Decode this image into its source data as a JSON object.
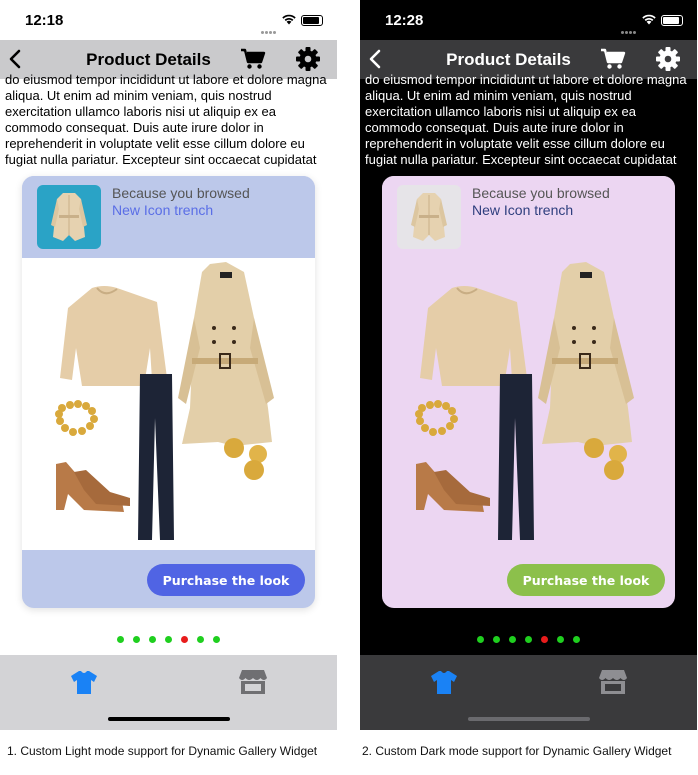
{
  "light": {
    "time": "12:18",
    "nav_title": "Product Details",
    "lorem": "do eiusmod tempor incididunt ut labore et dolore magna aliqua. Ut enim ad minim veniam, quis nostrud exercitation ullamco laboris nisi ut aliquip ex ea commodo consequat. Duis aute irure dolor in reprehenderit in voluptate velit esse cillum dolore eu fugiat nulla pariatur. Excepteur sint occaecat cupidatat",
    "because_label": "Because you browsed",
    "item_name": "New Icon trench",
    "purchase_label": "Purchase the look",
    "caption": "1. Custom Light mode support for Dynamic Gallery Widget",
    "colors": {
      "background": "#ffffff",
      "navbar": "#cacacc",
      "text": "#000000",
      "card_header": "#bcc8ea",
      "card_body": "#ffffff",
      "item_name": "#5a6ee6",
      "button": "#5064e4",
      "tabbar": "#d3d3d6",
      "tab_active": "#1a82f5"
    }
  },
  "dark": {
    "time": "12:28",
    "nav_title": "Product Details",
    "lorem": "do eiusmod tempor incididunt ut labore et dolore magna aliqua. Ut enim ad minim veniam, quis nostrud exercitation ullamco laboris nisi ut aliquip ex ea commodo consequat. Duis aute irure dolor in reprehenderit in voluptate velit esse cillum dolore eu fugiat nulla pariatur. Excepteur sint occaecat cupidatat",
    "because_label": "Because you browsed",
    "item_name": "New Icon trench",
    "purchase_label": "Purchase the look",
    "caption": "2. Custom Dark mode support for Dynamic Gallery Widget",
    "colors": {
      "background": "#000000",
      "navbar": "#3a3a3c",
      "text": "#ffffff",
      "card_header": "#ecd6f2",
      "card_body": "#ecd6f2",
      "item_name": "#2e3e7e",
      "button": "#8cc04b",
      "tabbar": "#3a3a3c",
      "tab_active": "#1a82f5"
    }
  },
  "pager": {
    "count": 7,
    "active_index": 4,
    "active_color": "#e81c1c",
    "inactive_color": "#1fcf1f"
  },
  "icons": {
    "back": "chevron-left-icon",
    "cart": "cart-icon",
    "settings": "gear-icon",
    "tab_1": "tshirt-icon",
    "tab_2": "store-icon"
  }
}
